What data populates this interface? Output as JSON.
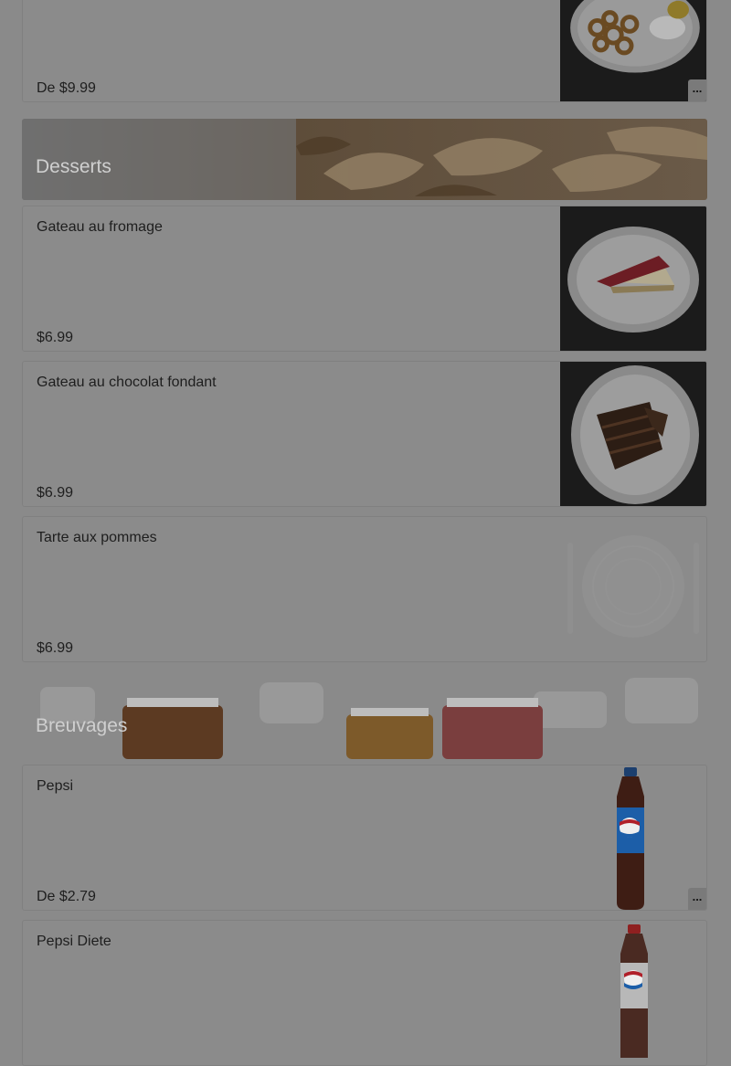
{
  "sections": {
    "desserts": {
      "title": "Desserts"
    },
    "beverages": {
      "title": "Breuvages"
    }
  },
  "items": {
    "top_partial": {
      "price": "De $9.99",
      "more": "..."
    },
    "cheesecake": {
      "name": "Gateau au fromage",
      "price": "$6.99"
    },
    "chocolate_cake": {
      "name": "Gateau au chocolat fondant",
      "price": "$6.99"
    },
    "apple_pie": {
      "name": "Tarte aux pommes",
      "price": "$6.99"
    },
    "pepsi": {
      "name": "Pepsi",
      "price": "De $2.79",
      "more": "..."
    },
    "diet_pepsi": {
      "name": "Pepsi Diete"
    }
  },
  "colors": {
    "overlay_bg": "#8a8a8a",
    "card_bg": "#8b8b8b",
    "section_text": "#cfcfcf",
    "pepsi_blue": "#1c5ea8",
    "pepsi_red": "#b0202a"
  }
}
